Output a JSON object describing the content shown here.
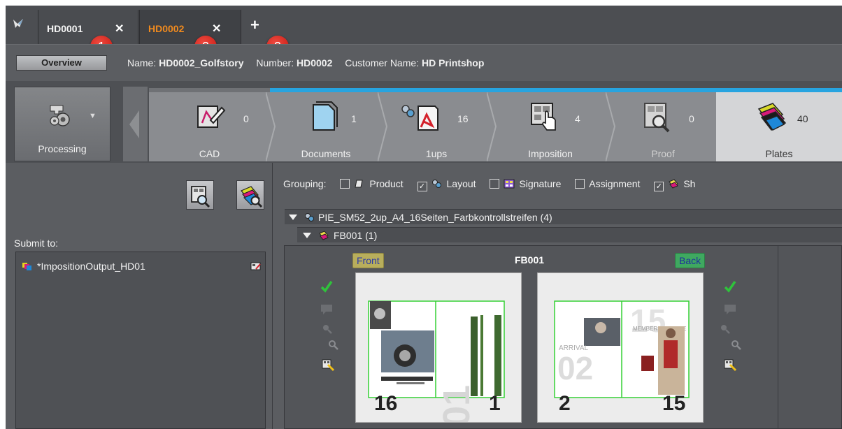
{
  "tabs": [
    {
      "label": "HD0001",
      "close": "✕"
    },
    {
      "label": "HD0002",
      "close": "✕"
    }
  ],
  "tab_add": "+",
  "callouts": [
    "1",
    "2",
    "3"
  ],
  "header": {
    "overview_label": "Overview",
    "name_label": "Name:",
    "name_value": "HD0002_Golfstory",
    "number_label": "Number:",
    "number_value": "HD0002",
    "customer_label": "Customer Name:",
    "customer_value": "HD Printshop"
  },
  "processing": {
    "label": "Processing"
  },
  "workflow_steps": [
    {
      "label": "CAD",
      "count": "0",
      "icon": "cad-pencil-icon",
      "active": false
    },
    {
      "label": "Documents",
      "count": "1",
      "icon": "documents-icon",
      "active": true
    },
    {
      "label": "1ups",
      "count": "16",
      "icon": "oneups-pdf-icon",
      "active": true
    },
    {
      "label": "Imposition",
      "count": "4",
      "icon": "imposition-hand-icon",
      "active": true
    },
    {
      "label": "Proof",
      "count": "0",
      "icon": "proof-magnifier-icon",
      "active": true
    },
    {
      "label": "Plates",
      "count": "40",
      "icon": "plates-stack-icon",
      "active": true
    }
  ],
  "left_panel": {
    "submit_to_label": "Submit to:",
    "submit_items": [
      "*ImpositionOutput_HD01"
    ]
  },
  "grouping": {
    "label": "Grouping:",
    "options": [
      {
        "label": "Product",
        "checked": false
      },
      {
        "label": "Layout",
        "checked": true
      },
      {
        "label": "Signature",
        "checked": false
      },
      {
        "label": "Assignment",
        "checked": false
      },
      {
        "label": "Sh",
        "checked": true
      }
    ]
  },
  "tree": {
    "layout_node": "PIE_SM52_2up_A4_16Seiten_Farbkontrollstreifen (4)",
    "sheet_node": "FB001 (1)"
  },
  "sheet": {
    "title": "FB001",
    "front_label": "Front",
    "back_label": "Back",
    "front_pages": [
      "16",
      "1"
    ],
    "back_pages": [
      "2",
      "15"
    ]
  },
  "colors": {
    "accent_active": "#27a4e0",
    "tab_active_text": "#f08a1e",
    "badge_red": "#d8241b",
    "front_pill": "#b8ae5c",
    "back_pill": "#3fa860",
    "bleed_green": "#35d135"
  }
}
